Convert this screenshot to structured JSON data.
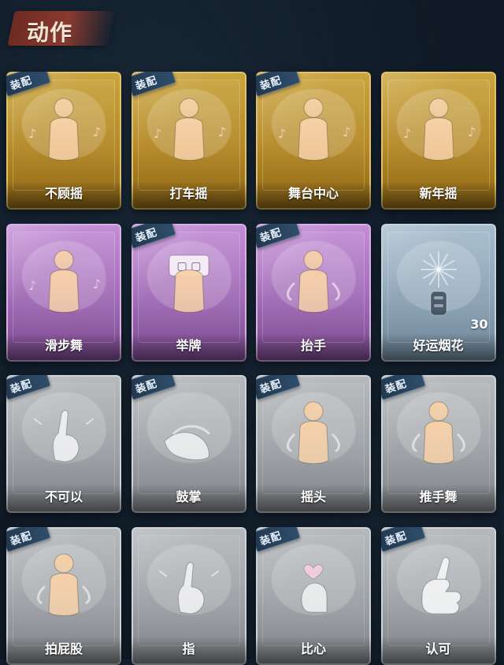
{
  "header": {
    "title": "动作"
  },
  "equip_label": "装配",
  "colors": {
    "background": "#0f1a26",
    "header_brush": "#8a3a2f",
    "gold": "#caa43d",
    "purple": "#c38ed6",
    "blue": "#a7bccc",
    "gray": "#b5b9bc",
    "equip_ribbon": "#2f4d6a"
  },
  "items": [
    {
      "label": "不顾摇",
      "theme": "gold",
      "equipped": true,
      "icon": "dancer-pointing-icon"
    },
    {
      "label": "打车摇",
      "theme": "gold",
      "equipped": true,
      "icon": "dancer-hand-to-shoulder-icon"
    },
    {
      "label": "舞台中心",
      "theme": "gold",
      "equipped": true,
      "icon": "dancer-center-stage-icon"
    },
    {
      "label": "新年摇",
      "theme": "gold",
      "equipped": false,
      "icon": "dancer-new-year-icon"
    },
    {
      "label": "滑步舞",
      "theme": "purple",
      "equipped": false,
      "icon": "dancer-slide-step-icon"
    },
    {
      "label": "举牌",
      "theme": "purple",
      "equipped": true,
      "icon": "hold-sign-icon"
    },
    {
      "label": "抬手",
      "theme": "purple",
      "equipped": true,
      "icon": "raise-hand-icon"
    },
    {
      "label": "好运烟花",
      "theme": "blue",
      "equipped": false,
      "icon": "firework-icon",
      "count": "30"
    },
    {
      "label": "不可以",
      "theme": "gray",
      "equipped": true,
      "icon": "finger-wag-icon"
    },
    {
      "label": "鼓掌",
      "theme": "gray",
      "equipped": true,
      "icon": "clap-icon"
    },
    {
      "label": "摇头",
      "theme": "gray",
      "equipped": true,
      "icon": "shake-head-icon"
    },
    {
      "label": "推手舞",
      "theme": "gray",
      "equipped": true,
      "icon": "push-hand-dance-icon"
    },
    {
      "label": "拍屁股",
      "theme": "gray",
      "equipped": true,
      "icon": "pat-bottom-icon"
    },
    {
      "label": "指",
      "theme": "gray",
      "equipped": false,
      "icon": "point-icon"
    },
    {
      "label": "比心",
      "theme": "gray",
      "equipped": true,
      "icon": "finger-heart-icon"
    },
    {
      "label": "认可",
      "theme": "gray",
      "equipped": true,
      "icon": "thumbs-up-icon"
    }
  ]
}
